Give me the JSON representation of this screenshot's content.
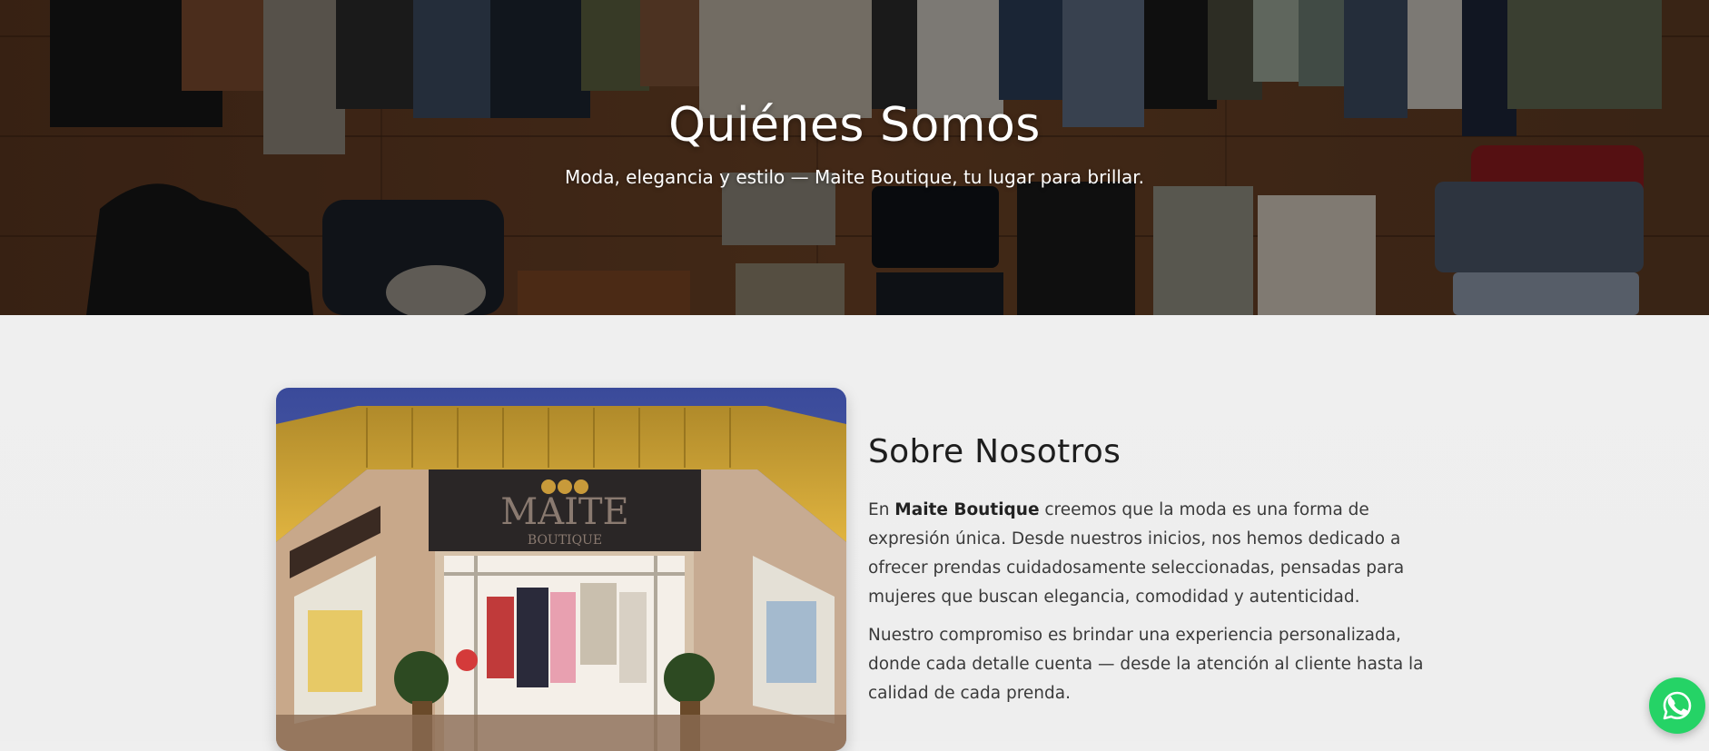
{
  "hero": {
    "title": "Quiénes Somos",
    "subtitle": "Moda, elegancia y estilo — Maite Boutique, tu lugar para brillar."
  },
  "about": {
    "heading": "Sobre Nosotros",
    "p1_prefix": "En ",
    "p1_brand": "Maite Boutique",
    "p1_rest": " creemos que la moda es una forma de expresión única. Desde nuestros inicios, nos hemos dedicado a ofrecer prendas cuidadosamente seleccionadas, pensadas para mujeres que buscan elegancia, comodidad y autenticidad.",
    "p2": "Nuestro compromiso es brindar una experiencia personalizada, donde cada detalle cuenta — desde la atención al cliente hasta la calidad de cada prenda.",
    "photo_sign_main": "MAITE",
    "photo_sign_sub": "BOUTIQUE"
  },
  "icons": {
    "whatsapp": "whatsapp-icon"
  },
  "colors": {
    "whatsapp_green": "#25d366",
    "background": "#efefef",
    "text": "#3a3a3a"
  }
}
